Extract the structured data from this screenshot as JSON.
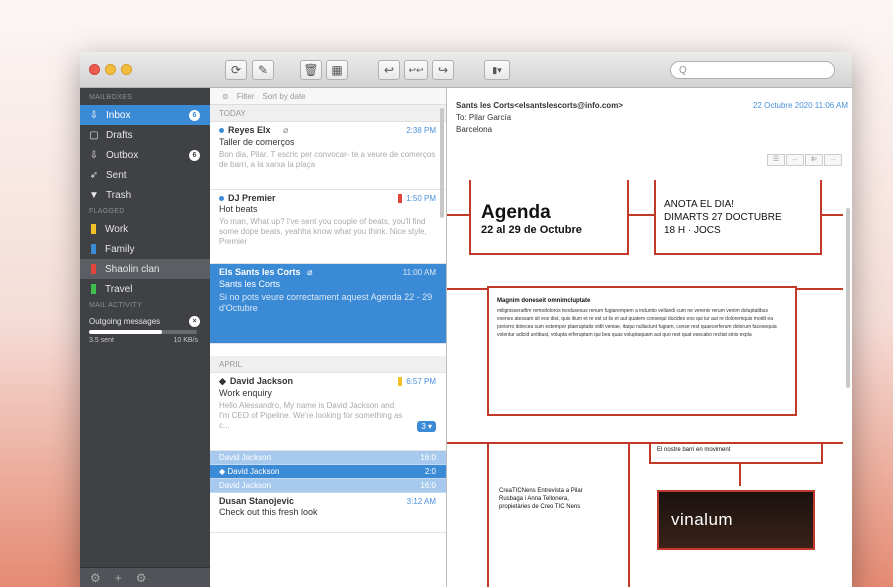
{
  "window": {
    "search_placeholder": "Q"
  },
  "toolbar": {
    "buttons": [
      "⟳",
      "✎",
      "🗑",
      "▦",
      "↩",
      "↩↩",
      "↪",
      "▮▾"
    ]
  },
  "sidebar": {
    "mailboxes_header": "MAILBOXES",
    "mailboxes": [
      {
        "icon": "inbox-icon",
        "glyph": "⇩",
        "label": "Inbox",
        "badge": "6",
        "selected": true
      },
      {
        "icon": "drafts-icon",
        "glyph": "▢",
        "label": "Drafts",
        "badge": ""
      },
      {
        "icon": "outbox-icon",
        "glyph": "⇩",
        "label": "Outbox",
        "badge": "6"
      },
      {
        "icon": "sent-icon",
        "glyph": "➶",
        "label": "Sent",
        "badge": ""
      },
      {
        "icon": "trash-icon",
        "glyph": "▼",
        "label": "Trash",
        "badge": ""
      }
    ],
    "flagged_header": "FLAGGED",
    "flagged": [
      {
        "label": "Work",
        "color": "#f3c12a"
      },
      {
        "label": "Family",
        "color": "#3b8ad6"
      },
      {
        "label": "Shaolin clan",
        "color": "#e0443a",
        "highlight": true
      },
      {
        "label": "Travel",
        "color": "#3fbf4f"
      }
    ],
    "activity_header": "MAIL ACTIVITY",
    "activity_label": "Outgoing messages",
    "activity_progress": 0.68,
    "activity_left": "3.5 sent",
    "activity_right": "10 KB/s",
    "bottom_icons": [
      "⚙",
      "+",
      "⚙"
    ]
  },
  "list": {
    "filter_label": "Filter",
    "filter_sort": "Sort by date",
    "today_header": "TODAY",
    "april_header": "APRIL",
    "today": [
      {
        "from": "Reyes Elx",
        "time": "2:38 PM",
        "subject": "Taller de comerços",
        "preview": "Bon dia, Pilar. T escric per convocar- te a veure de comerços de barri, a la xarxa la plaça",
        "flag": "",
        "unread": true
      },
      {
        "from": "DJ Premier",
        "time": "1:50 PM",
        "subject": "Hot beats",
        "preview": "Yo man, What up? I've sent you couple of beats, you'll find some dope beats, yeahha know what you think. Nice style, Premier",
        "flag": "#e0443a",
        "unread": true
      },
      {
        "from": "Els Sants les Corts",
        "time": "11:00 AM",
        "subject": "Sants les Corts",
        "preview": "Si no pots veure correctament aquest Agenda 22 - 29 d'Octubre",
        "flag": "",
        "unread": false,
        "selected": true
      }
    ],
    "april": [
      {
        "from": "David Jackson",
        "time": "6:57 PM",
        "subject": "Work enquiry",
        "preview": "Hello Alessandro, My name is David Jackson and I'm CEO of Pipeline. We're looking for something as c...",
        "flag": "#f3c12a",
        "unread": false,
        "count": "3 ▾"
      }
    ],
    "thread": [
      {
        "from": "David Jackson",
        "time": "16:0"
      },
      {
        "from": "◆ David Jackson",
        "time": "2:0"
      },
      {
        "from": "David Jackson",
        "time": "16:0"
      }
    ],
    "last": {
      "from": "Dusan Stanojevic",
      "time": "3:12 AM",
      "subject": "Check out this fresh look"
    }
  },
  "reader": {
    "from": "Sants les Corts<elsantslescorts@info.com>",
    "date": "22 Octubre 2020 11:06 AM",
    "to": "To: Pilar García",
    "cc": "Barcelona",
    "buttons": [
      "☰",
      "←",
      "⇇",
      "→"
    ]
  },
  "poster": {
    "agenda_title": "Agenda",
    "agenda_sub": "22 al 29 de Octubre",
    "note_line1": "ANOTA EL DIA!",
    "note_line2": "DIMARTS 27 DOCTUBRE",
    "note_line3": "18 H · JOCS",
    "article_title": "Magnim doneseit omnimcluptate",
    "article_body": "milignisseratfim remodoloros teodusesus renum fugiarempem a induntio vellandi cum ne vereniv rerum venim doluptatibus exenes atessam sit eos dist, quis ilium et re est ut lis et aut quatem consequi ducides eos qui iur aut re doloremquis modit ea poriorro dolecea sum estempor plaeruptatis vidit veniae, itaqui nullaciunt fugiam, conse rest quaecerferum dolorum facesequia volentur adicid untibust, volupta erferuptam qui bea quas voluptaquam aut quo rest quat esecabo rectiat sinis expla",
    "event_label": "El nostre barri en moviment",
    "bottom_text": "CreaTICNens Entrevista a Pilar Rusbaga i Anna Tellonera, propietàries de Creo TIC Nens",
    "brand": "vinalum"
  }
}
